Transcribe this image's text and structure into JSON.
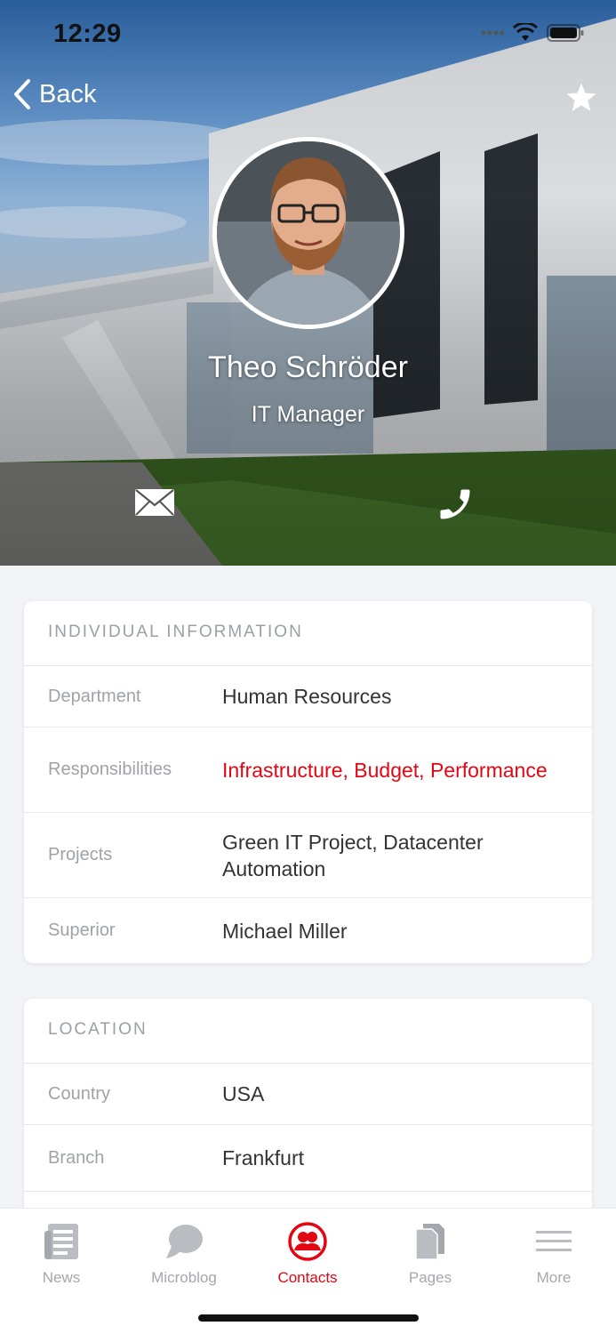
{
  "status_bar": {
    "time": "12:29"
  },
  "nav": {
    "back_label": "Back"
  },
  "profile": {
    "name": "Theo Schröder",
    "role": "IT Manager"
  },
  "individual_information": {
    "title": "INDIVIDUAL INFORMATION",
    "rows": [
      {
        "label": "Department",
        "value": "Human Resources"
      },
      {
        "label": "Responsibilities",
        "value": "Infrastructure, Budget, Performance"
      },
      {
        "label": "Projects",
        "value": "Green IT Project, Datacenter Automation"
      },
      {
        "label": "Superior",
        "value": "Michael Miller"
      }
    ]
  },
  "location": {
    "title": "LOCATION",
    "rows": [
      {
        "label": "Country",
        "value": "USA"
      },
      {
        "label": "Branch",
        "value": "Frankfurt"
      }
    ]
  },
  "tabs": [
    {
      "label": "News",
      "icon": "news-icon",
      "active": false
    },
    {
      "label": "Microblog",
      "icon": "chat-bubble-icon",
      "active": false
    },
    {
      "label": "Contacts",
      "icon": "contacts-icon",
      "active": true
    },
    {
      "label": "Pages",
      "icon": "pages-icon",
      "active": false
    },
    {
      "label": "More",
      "icon": "menu-icon",
      "active": false
    }
  ],
  "colors": {
    "accent": "#e30613",
    "tab_inactive": "#a4a8ad",
    "label": "#9ea3a8"
  }
}
